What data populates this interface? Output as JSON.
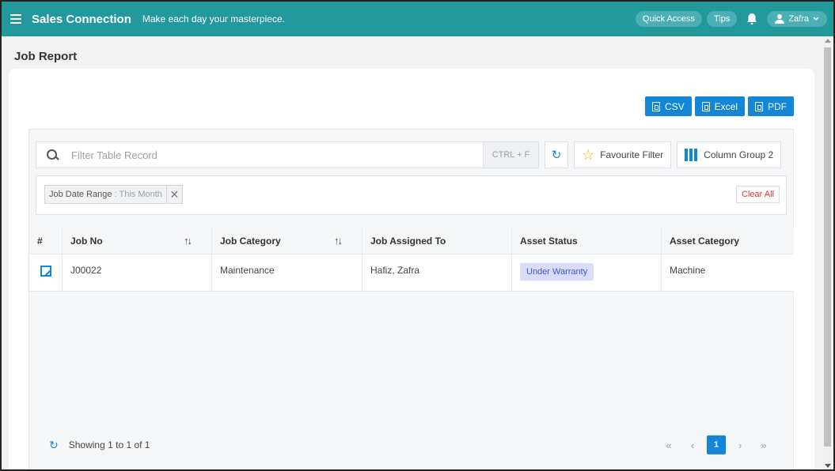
{
  "topbar": {
    "brand": "Sales Connection",
    "tagline": "Make each day your masterpiece.",
    "quick_access": "Quick Access",
    "tips": "Tips",
    "user": "Zafra",
    "accent": "#23999c"
  },
  "page": {
    "title": "Job Report"
  },
  "export": {
    "csv": "CSV",
    "excel": "Excel",
    "pdf": "PDF"
  },
  "search": {
    "placeholder": "Filter Table Record",
    "value": "",
    "shortcut": "CTRL + F",
    "favourite_filter": "Favourite Filter",
    "column_group": "Column Group 2"
  },
  "filters": {
    "chip_label": "Job Date Range",
    "chip_separator": " : ",
    "chip_value": "This Month",
    "clear_all": "Clear All"
  },
  "table": {
    "columns": [
      "#",
      "Job No",
      "Job Category",
      "Job Assigned To",
      "Asset Status",
      "Asset Category"
    ],
    "rows": [
      {
        "job_no": "J00022",
        "job_category": "Maintenance",
        "assigned_to": "Hafiz, Zafra",
        "asset_status": "Under Warranty",
        "asset_category": "Machine"
      }
    ]
  },
  "footer": {
    "showing": "Showing 1 to 1 of 1",
    "first": "«",
    "prev": "‹",
    "current_page": "1",
    "next": "›",
    "last": "»"
  }
}
